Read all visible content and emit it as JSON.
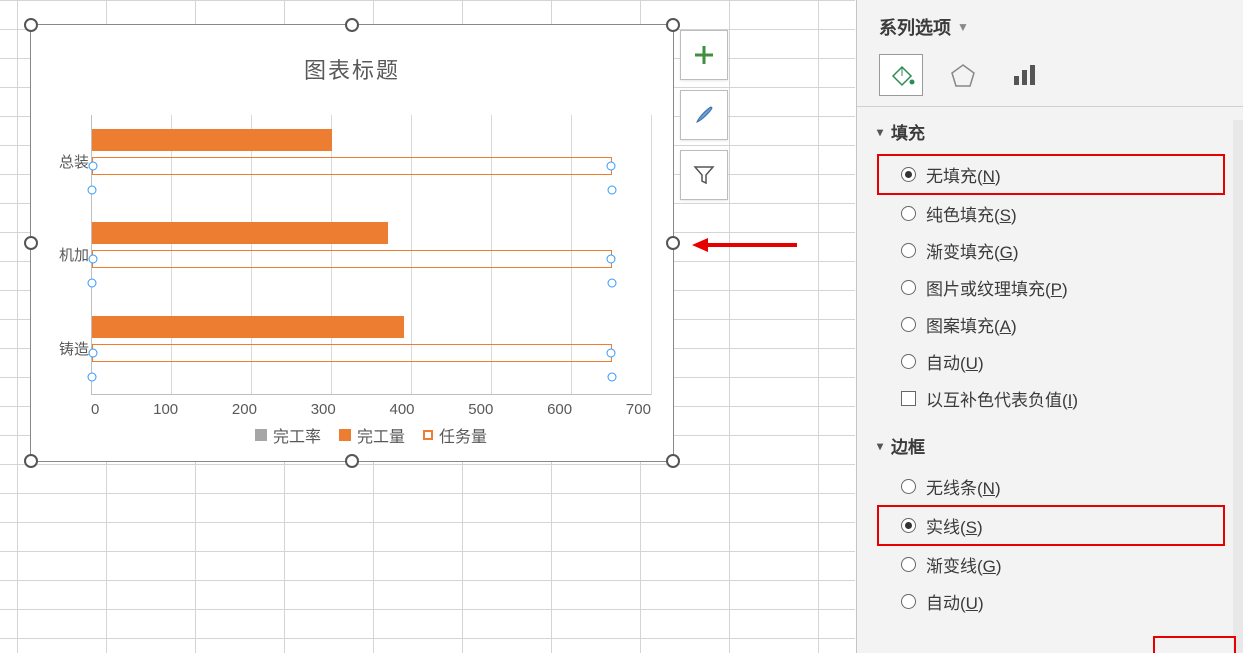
{
  "chart_data": {
    "type": "bar",
    "title": "图表标题",
    "categories": [
      "总装",
      "机加",
      "铸造"
    ],
    "series": [
      {
        "name": "完工率",
        "values": [
          0,
          0,
          0
        ]
      },
      {
        "name": "完工量",
        "values": [
          300,
          370,
          390
        ]
      },
      {
        "name": "任务量",
        "values": [
          650,
          650,
          650
        ]
      }
    ],
    "xlim": [
      0,
      700
    ],
    "x_ticks": [
      0,
      100,
      200,
      300,
      400,
      500,
      600,
      700
    ],
    "legend": [
      "完工率",
      "完工量",
      "任务量"
    ]
  },
  "chart_tools": {
    "add": "+",
    "brush": "brush-icon",
    "filter": "filter-icon"
  },
  "format_pane": {
    "header": "系列选项",
    "sections": {
      "fill": {
        "title": "填充",
        "options": {
          "none": {
            "label_pre": "无填充(",
            "hotkey": "N",
            "label_post": ")"
          },
          "solid": {
            "label_pre": "纯色填充(",
            "hotkey": "S",
            "label_post": ")"
          },
          "gradient": {
            "label_pre": "渐变填充(",
            "hotkey": "G",
            "label_post": ")"
          },
          "picture": {
            "label_pre": "图片或纹理填充(",
            "hotkey": "P",
            "label_post": ")"
          },
          "pattern": {
            "label_pre": "图案填充(",
            "hotkey": "A",
            "label_post": ")"
          },
          "auto": {
            "label_pre": "自动(",
            "hotkey": "U",
            "label_post": ")"
          },
          "invert": {
            "label_pre": "以互补色代表负值(",
            "hotkey": "I",
            "label_post": ")"
          }
        }
      },
      "border": {
        "title": "边框",
        "options": {
          "none": {
            "label_pre": "无线条(",
            "hotkey": "N",
            "label_post": ")"
          },
          "solid": {
            "label_pre": "实线(",
            "hotkey": "S",
            "label_post": ")"
          },
          "gradient": {
            "label_pre": "渐变线(",
            "hotkey": "G",
            "label_post": ")"
          },
          "auto": {
            "label_pre": "自动(",
            "hotkey": "U",
            "label_post": ")"
          }
        }
      }
    }
  }
}
